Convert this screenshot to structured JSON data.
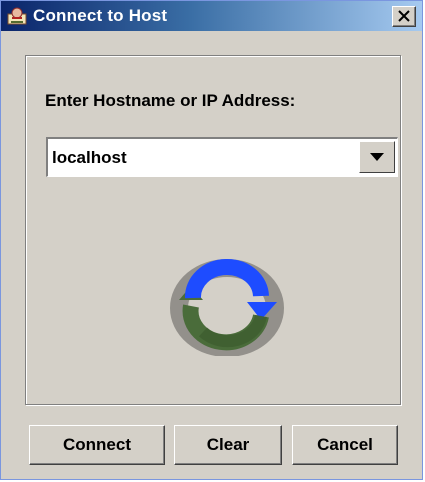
{
  "window": {
    "title": "Connect to Host",
    "title_icon": "app-icon",
    "close_icon": "close-icon"
  },
  "form": {
    "host_label": "Enter Hostname or IP Address:",
    "host_value": "localhost",
    "dropdown_icon": "chevron-down-icon"
  },
  "center_icon": "refresh-icon",
  "buttons": {
    "connect": "Connect",
    "clear": "Clear",
    "cancel": "Cancel"
  },
  "colors": {
    "title_start": "#0a246a",
    "title_end": "#a6caf0",
    "dialog_bg": "#d4d0c8",
    "arrow_blue": "#1e4cff",
    "arrow_green": "#4a6c3a"
  }
}
